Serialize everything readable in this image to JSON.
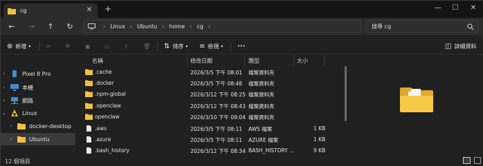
{
  "tab": {
    "title": "cg",
    "close": "✕",
    "new": "+"
  },
  "window_controls": {
    "minimize": "—",
    "maximize": "☐",
    "close": "✕"
  },
  "nav": {
    "back": "←",
    "forward": "→",
    "up": "↑",
    "refresh": "↻",
    "breadcrumbs": [
      "Linux",
      "Ubuntu",
      "home",
      "cg"
    ],
    "search_placeholder": "搜尋 cg"
  },
  "toolbar": {
    "new_label": "新增",
    "sort_label": "排序",
    "view_label": "檢視",
    "more": "···",
    "details_label": "詳細資料"
  },
  "sidebar": {
    "items": [
      {
        "label": "Pixel 8 Pro",
        "icon": "phone-icon",
        "expandable": true
      },
      {
        "label": "本機",
        "icon": "pc-icon",
        "expandable": true
      },
      {
        "label": "網路",
        "icon": "network-icon",
        "expandable": true
      },
      {
        "label": "Linux",
        "icon": "linux-icon",
        "expandable": true,
        "expanded": true
      },
      {
        "label": "docker-desktop",
        "icon": "folder-icon",
        "expandable": true
      },
      {
        "label": "Ubuntu",
        "icon": "folder-icon",
        "expandable": true,
        "selected": true
      }
    ]
  },
  "columns": {
    "name": "名稱",
    "modified": "修改日期",
    "type": "類型",
    "size": "大小"
  },
  "files": [
    {
      "name": ".cache",
      "modified": "2026/3/5 下午 08:01",
      "type": "檔案資料夾",
      "size": "",
      "kind": "folder"
    },
    {
      "name": ".docker",
      "modified": "2026/3/5 下午 08:48",
      "type": "檔案資料夾",
      "size": "",
      "kind": "folder"
    },
    {
      "name": ".npm-global",
      "modified": "2026/3/12 下午 08:25",
      "type": "檔案資料夾",
      "size": "",
      "kind": "folder"
    },
    {
      "name": ".openclaw",
      "modified": "2026/3/12 下午 08:43",
      "type": "檔案資料夾",
      "size": "",
      "kind": "folder"
    },
    {
      "name": "openclaw",
      "modified": "2026/3/10 下午 09:04",
      "type": "檔案資料夾",
      "size": "",
      "kind": "folder"
    },
    {
      "name": ".aws",
      "modified": "2026/3/5 下午 08:11",
      "type": "AWS 檔案",
      "size": "1 KB",
      "kind": "file"
    },
    {
      "name": ".azure",
      "modified": "2026/3/5 下午 08:11",
      "type": "AZURE 檔案",
      "size": "1 KB",
      "kind": "file"
    },
    {
      "name": ".bash_history",
      "modified": "2026/3/12 下午 08:34",
      "type": "BASH_HISTORY ...",
      "size": "9 KB",
      "kind": "file"
    }
  ],
  "status": {
    "count_text": "12 個項目"
  },
  "colors": {
    "folder": "#f0c23b",
    "background": "#202020",
    "selected": "#3a3a3a"
  }
}
